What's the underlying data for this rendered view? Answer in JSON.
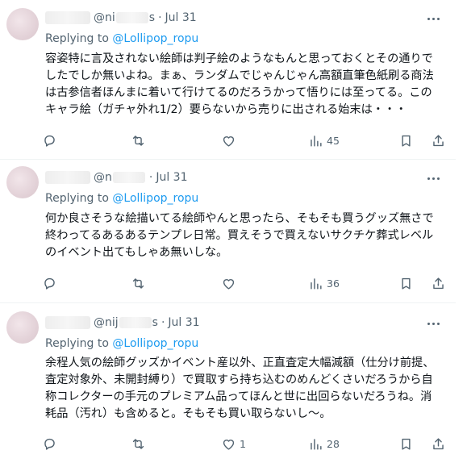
{
  "tweets": [
    {
      "handle_prefix": "@ni",
      "handle_suffix": "s",
      "date": "Jul 31",
      "replying_label": "Replying to",
      "replying_to": "@Lollipop_ropu",
      "text": "容姿特に言及されない絵師は判子絵のようなもんと思っておくとその通りで\nしたでしか無いよね。まぁ、ランダムでじゃんじゃん高額直筆色紙刷る商法\nは古参信者ほんまに着いて行けてるのだろうかって悟りには至ってる。この\nキャラ絵（ガチャ外れ1/2）要らないから売りに出される始末は・・・",
      "replies": "",
      "retweets": "",
      "likes": "",
      "views": "45"
    },
    {
      "handle_prefix": "@n",
      "handle_suffix": "",
      "date": "Jul 31",
      "replying_label": "Replying to",
      "replying_to": "@Lollipop_ropu",
      "text": "何か良さそうな絵描いてる絵師やんと思ったら、そもそも買うグッズ無さで\n終わってるあるあるテンプレ日常。買えそうで買えないサクチケ葬式レベル\nのイベント出てもしゃあ無いしな。",
      "replies": "",
      "retweets": "",
      "likes": "",
      "views": "36"
    },
    {
      "handle_prefix": "@nij",
      "handle_suffix": "s",
      "date": "Jul 31",
      "replying_label": "Replying to",
      "replying_to": "@Lollipop_ropu",
      "text": "余程人気の絵師グッズかイベント産以外、正直査定大幅減額（仕分け前提、\n査定対象外、未開封縛り）で買取すら持ち込むのめんどくさいだろうから自\n称コレクターの手元のプレミアム品ってほんと世に出回らないだろうね。消\n耗品（汚れ）も含めると。そもそも買い取らないし〜。",
      "replies": "",
      "retweets": "",
      "likes": "1",
      "views": "28"
    }
  ],
  "icons": {
    "reply": "reply-icon",
    "retweet": "retweet-icon",
    "like": "heart-icon",
    "views": "views-icon",
    "bookmark": "bookmark-icon",
    "share": "share-icon",
    "more": "more-icon"
  },
  "colors": {
    "text": "#0f1419",
    "secondary": "#536471",
    "link": "#1d9bf0",
    "divider": "#eff3f4"
  }
}
